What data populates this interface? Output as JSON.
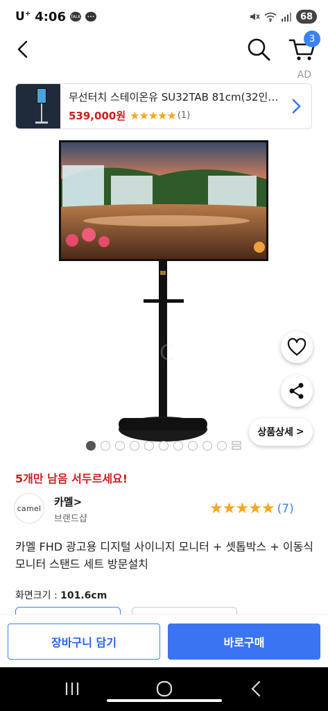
{
  "status": {
    "carrier": "U",
    "carrier_sup": "+",
    "time": "4:06",
    "talk_badge": "TALK",
    "battery": "68"
  },
  "nav": {
    "cart_count": "3"
  },
  "ad": {
    "label": "AD",
    "title": "무선터치 스테이온유 SU32TAB 81cm(32인치...",
    "price": "539,000원",
    "stars": "★★★★★",
    "review_count": "(1)"
  },
  "product_image": {
    "watermark": "C"
  },
  "floating": {
    "detail_label": "상품상세",
    "detail_chevron": ">"
  },
  "carousel": {
    "total_dots": 10,
    "active_index": 0
  },
  "urgency": "5개만 남음 서두르세요!",
  "brand": {
    "logo_text": "camel",
    "name": "카멜",
    "name_chevron": ">",
    "shop": "브랜드샵"
  },
  "rating": {
    "stars": "★★★★★",
    "count": "(7)"
  },
  "product_title": "카멜 FHD 광고용 디지털 사이니지 모니터 + 셋톱박스 + 이동식 모니터 스탠드 세트 방문설치",
  "spec": {
    "label": "화면크기 : ",
    "value": "101.6cm"
  },
  "actions": {
    "cart": "장바구니 담기",
    "buy": "바로구매"
  },
  "colors": {
    "accent": "#3b74f2",
    "urgent": "#c81e1e",
    "star": "#f5a623"
  }
}
